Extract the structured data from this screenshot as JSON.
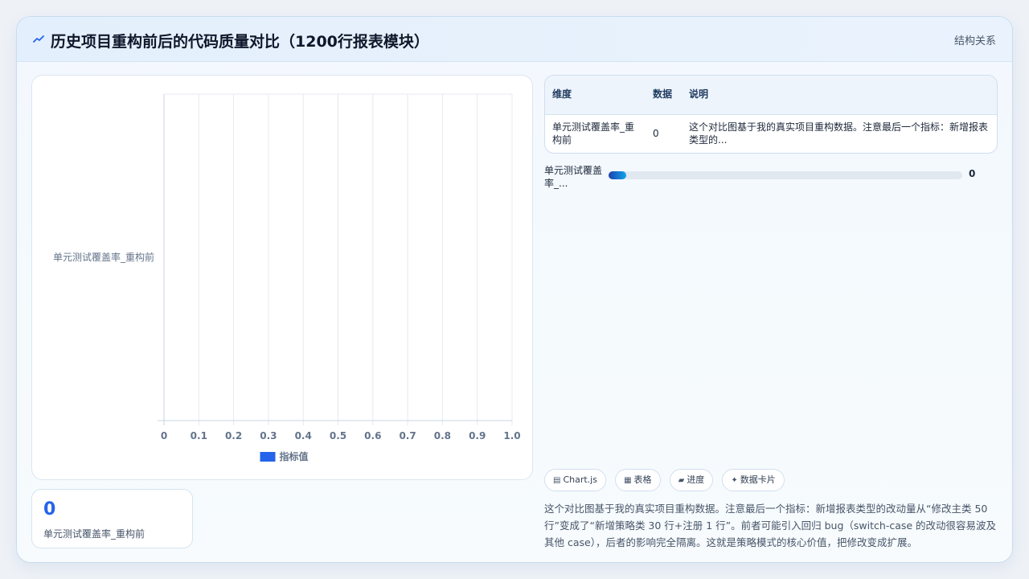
{
  "header": {
    "title": "历史项目重构前后的代码质量对比（1200行报表模块）",
    "link_label": "结构关系"
  },
  "chart_data": {
    "type": "bar",
    "orientation": "horizontal",
    "categories": [
      "单元测试覆盖率_重构前"
    ],
    "series": [
      {
        "name": "指标值",
        "values": [
          0
        ],
        "color": "#2563eb"
      }
    ],
    "x_ticks": [
      "0",
      "0.1",
      "0.2",
      "0.3",
      "0.4",
      "0.5",
      "0.6",
      "0.7",
      "0.8",
      "0.9",
      "1.0"
    ],
    "xlim": [
      0,
      1
    ],
    "grid": true,
    "legend_position": "bottom"
  },
  "stat_card": {
    "value": "0",
    "label": "单元测试覆盖率_重构前"
  },
  "table": {
    "headers": [
      "维度",
      "数据",
      "说明"
    ],
    "rows": [
      [
        "单元测试覆盖率_重构前",
        "0",
        "这个对比图基于我的真实项目重构数据。注意最后一个指标：新增报表类型的..."
      ]
    ]
  },
  "progress": {
    "label": "单元测试覆盖率_...",
    "value": "0",
    "percent": 0
  },
  "tags": [
    {
      "icon": "chart-icon",
      "glyph": "▤",
      "label": "Chart.js"
    },
    {
      "icon": "table-icon",
      "glyph": "▦",
      "label": "表格"
    },
    {
      "icon": "progress-icon",
      "glyph": "▰",
      "label": "进度"
    },
    {
      "icon": "card-icon",
      "glyph": "✦",
      "label": "数据卡片"
    }
  ],
  "description": "这个对比图基于我的真实项目重构数据。注意最后一个指标：新增报表类型的改动量从“修改主类 50 行”变成了“新增策略类 30 行+注册 1 行”。前者可能引入回归 bug（switch-case 的改动很容易波及其他 case），后者的影响完全隔离。这就是策略模式的核心价值，把修改变成扩展。"
}
